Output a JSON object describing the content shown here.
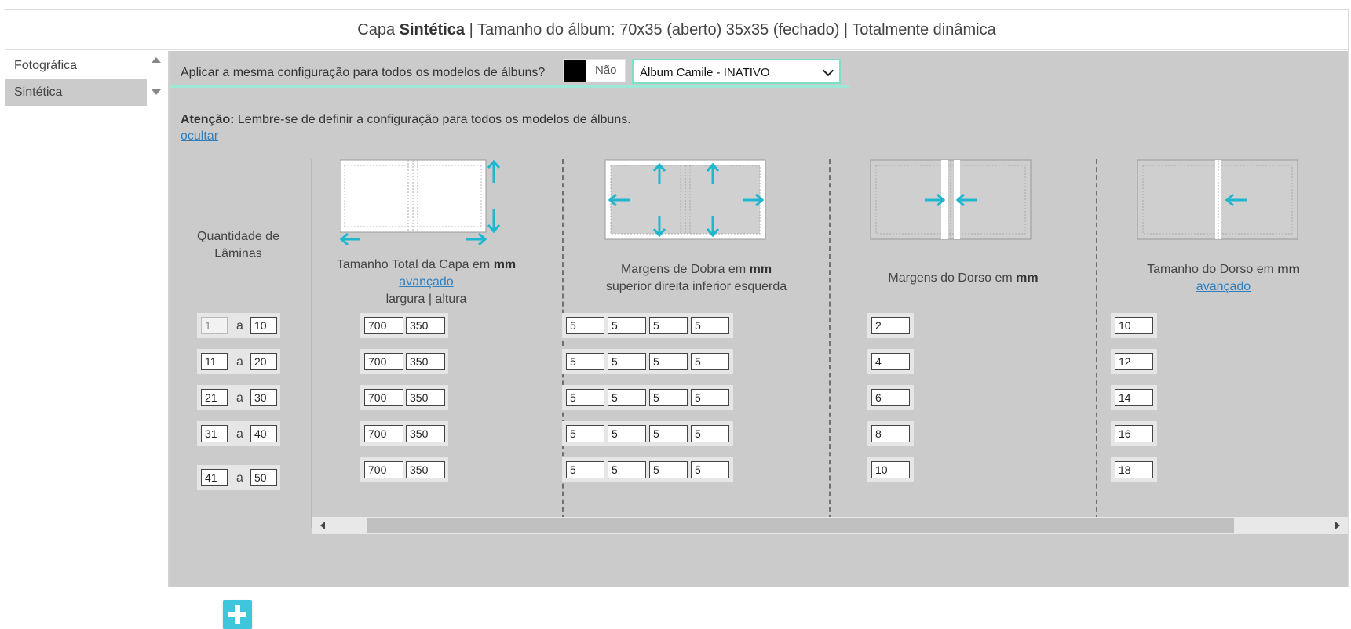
{
  "header": {
    "prefix": "Capa",
    "cover_type": "Sintética",
    "rest": "| Tamanho do álbum: 70x35 (aberto) 35x35 (fechado) | Totalmente dinâmica"
  },
  "sidebar": {
    "items": [
      {
        "label": "Fotográfica"
      },
      {
        "label": "Sintética"
      }
    ]
  },
  "apply": {
    "label": "Aplicar a mesma configuração para todos os modelos de álbuns?",
    "toggle_label": "Não",
    "select_value": "Álbum Camile - INATIVO"
  },
  "notice": {
    "bold": "Atenção:",
    "text": "Lembre-se de definir a configuração para todos os modelos de álbuns.",
    "hide_link": "ocultar"
  },
  "columns": {
    "qty_title": "Quantidade de Lâminas",
    "range_sep": "a",
    "cover_size": {
      "title": "Tamanho Total da Capa em",
      "unit": "mm",
      "link": "avançado",
      "sub": "largura | altura"
    },
    "fold_margins": {
      "title": "Margens de Dobra em",
      "unit": "mm",
      "sub": "superior direita inferior esquerda"
    },
    "spine_margins": {
      "title": "Margens do Dorso em",
      "unit": "mm"
    },
    "spine_size": {
      "title": "Tamanho do Dorso em",
      "unit": "mm",
      "link": "avançado"
    }
  },
  "rows": [
    {
      "from": "1",
      "to": "10",
      "width": "700",
      "height": "350",
      "m_top": "5",
      "m_right": "5",
      "m_bottom": "5",
      "m_left": "5",
      "spine_margin": "2",
      "spine_size": "10"
    },
    {
      "from": "11",
      "to": "20",
      "width": "700",
      "height": "350",
      "m_top": "5",
      "m_right": "5",
      "m_bottom": "5",
      "m_left": "5",
      "spine_margin": "4",
      "spine_size": "12"
    },
    {
      "from": "21",
      "to": "30",
      "width": "700",
      "height": "350",
      "m_top": "5",
      "m_right": "5",
      "m_bottom": "5",
      "m_left": "5",
      "spine_margin": "6",
      "spine_size": "14"
    },
    {
      "from": "31",
      "to": "40",
      "width": "700",
      "height": "350",
      "m_top": "5",
      "m_right": "5",
      "m_bottom": "5",
      "m_left": "5",
      "spine_margin": "8",
      "spine_size": "16"
    },
    {
      "from": "41",
      "to": "50",
      "width": "700",
      "height": "350",
      "m_top": "5",
      "m_right": "5",
      "m_bottom": "5",
      "m_left": "5",
      "spine_margin": "10",
      "spine_size": "18"
    }
  ],
  "colors": {
    "accent": "#3ec7dc",
    "panel": "#cbcbcb",
    "select_border": "#7ddfc6",
    "link": "#2e7fc0"
  },
  "icons": {
    "add": "plus-icon",
    "arrows": "arrow-icon"
  }
}
